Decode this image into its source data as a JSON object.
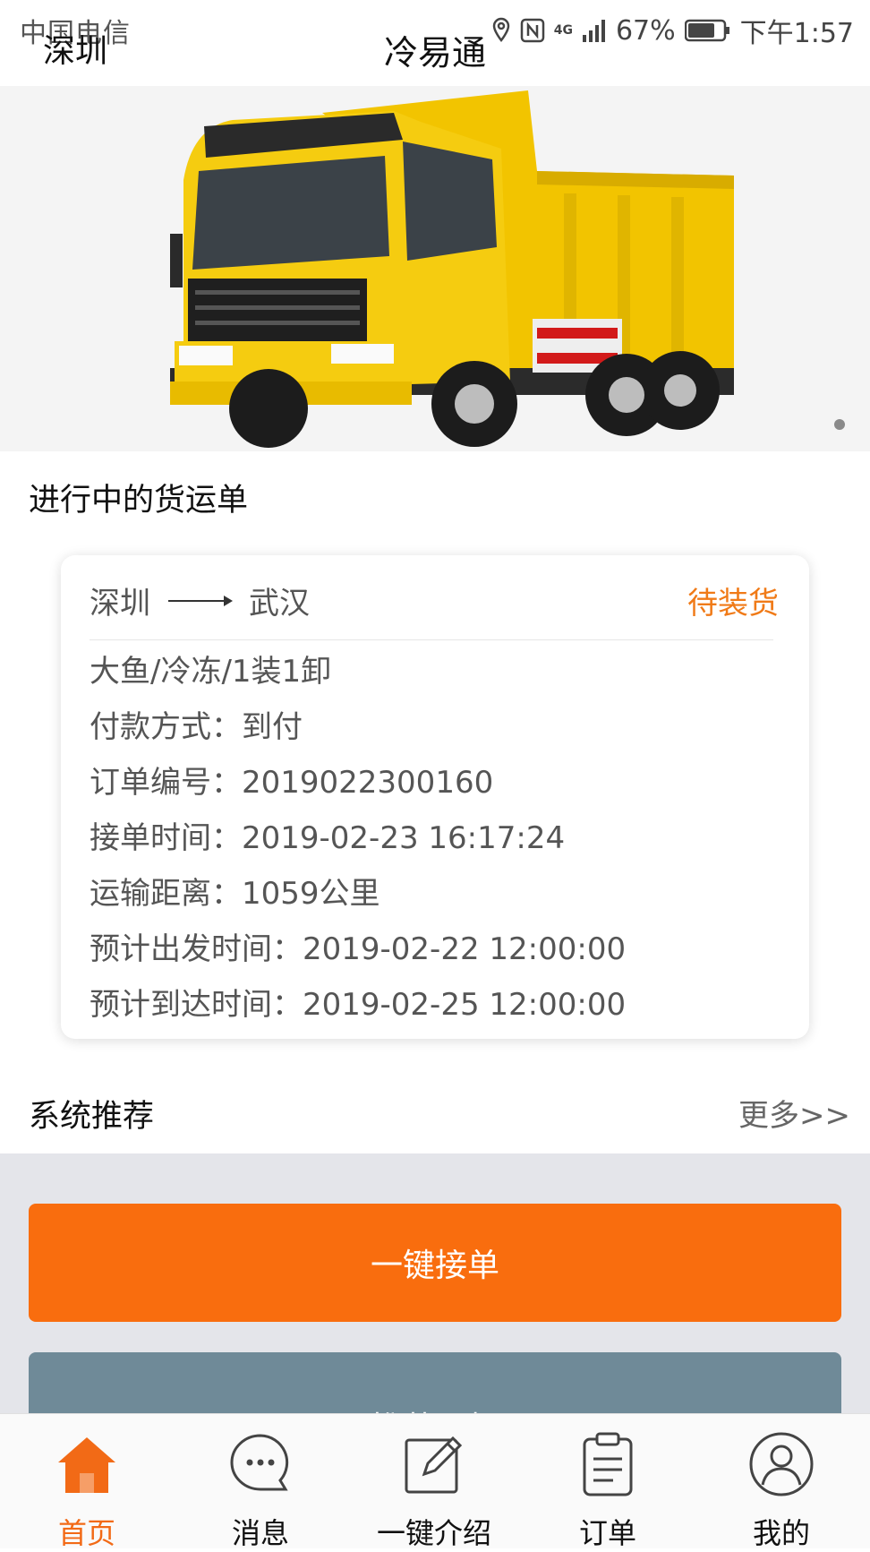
{
  "status_bar": {
    "carrier": "中国电信",
    "battery": "67%",
    "time": "下午1:57",
    "network": "4G"
  },
  "header": {
    "city": "深圳",
    "title": "冷易通"
  },
  "banner": {
    "image": "yellow-dump-truck"
  },
  "in_progress": {
    "title": "进行中的货运单",
    "order": {
      "from": "深圳",
      "to": "武汉",
      "status": "待装货",
      "status_color": "#f07a17",
      "cargo": "大鱼/冷冻/1装1卸",
      "payment_label": "付款方式：",
      "payment": "到付",
      "order_no_label": "订单编号：",
      "order_no": "2019022300160",
      "accept_time_label": "接单时间：",
      "accept_time": "2019-02-23 16:17:24",
      "distance_label": "运输距离：",
      "distance": "1059公里",
      "depart_label": "预计出发时间：",
      "depart": "2019-02-22 12:00:00",
      "arrive_label": "预计到达时间：",
      "arrive": "2019-02-25 12:00:00"
    }
  },
  "recommend": {
    "title": "系统推荐",
    "more": "更多>>"
  },
  "buttons": {
    "accept": "一键接单",
    "recommend_driver": "推荐司机"
  },
  "tabbar": {
    "accent": "#f26a16",
    "items": [
      {
        "label": "首页",
        "icon": "home-icon",
        "active": true
      },
      {
        "label": "消息",
        "icon": "chat-icon"
      },
      {
        "label": "一键介绍",
        "icon": "edit-icon"
      },
      {
        "label": "订单",
        "icon": "clipboard-icon"
      },
      {
        "label": "我的",
        "icon": "user-icon"
      }
    ]
  }
}
